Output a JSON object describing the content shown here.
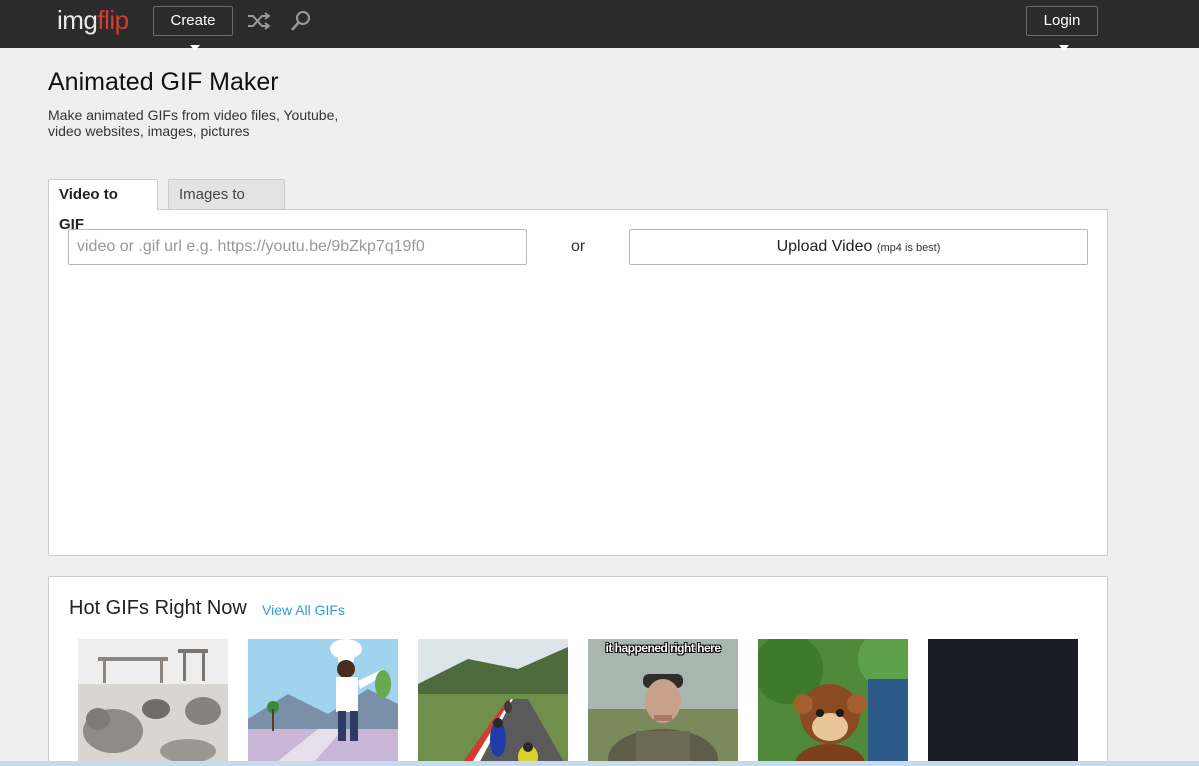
{
  "topbar": {
    "logo_part1": "img",
    "logo_part2": "flip",
    "create_label": "Create",
    "login_label": "Login",
    "colors": {
      "background": "#2b2b2b",
      "logo_accent": "#d43b32"
    }
  },
  "header": {
    "title": "Animated GIF Maker",
    "subtitle": "Make animated GIFs from video files, Youtube, video websites, images, pictures"
  },
  "tabs": [
    {
      "label": "Video to GIF",
      "active": true
    },
    {
      "label": "Images to GIF",
      "active": false
    }
  ],
  "video_form": {
    "url_placeholder": "video or .gif url e.g. https://youtu.be/9bZkp7q19f0",
    "url_value": "",
    "or_label": "or",
    "upload_label": "Upload Video",
    "upload_hint": "(mp4 is best)"
  },
  "hot_gifs": {
    "title": "Hot GIFs Right Now",
    "view_all_label": "View All GIFs",
    "link_color": "#2a9fd6",
    "items": [
      {
        "subject": "seals"
      },
      {
        "subject": "cartoon chef"
      },
      {
        "subject": "motorcycle race"
      },
      {
        "subject": "old man",
        "caption": "it happened right here"
      },
      {
        "subject": "monkey puppet"
      },
      {
        "subject": "dark"
      }
    ]
  }
}
